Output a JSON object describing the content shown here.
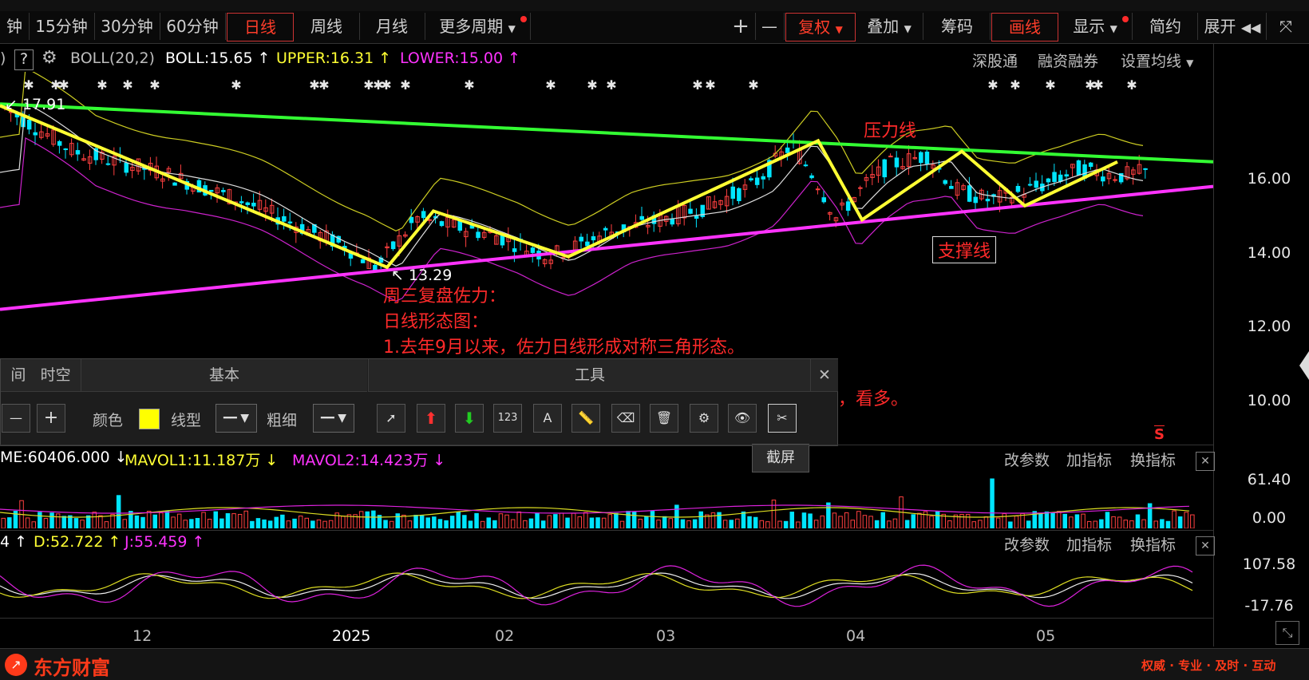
{
  "toolbar": {
    "periods": [
      "钟",
      "15分钟",
      "30分钟",
      "60分钟",
      "日线",
      "周线",
      "月线",
      "更多周期"
    ],
    "active_period": "日线",
    "right": [
      "复权",
      "叠加",
      "筹码",
      "画线",
      "显示",
      "简约",
      "展开"
    ],
    "plus": "+",
    "minus": "—"
  },
  "boll": {
    "qmark": "?",
    "name": "BOLL(20,2)",
    "boll": "BOLL:15.65",
    "upper": "UPPER:16.31",
    "lower": "LOWER:15.00",
    "links": [
      "深股通",
      "融资融券",
      "设置均线"
    ]
  },
  "price": {
    "high_label": "17.91",
    "low_label": "13.29",
    "axis": [
      "16.00",
      "14.00",
      "12.00",
      "10.00"
    ]
  },
  "annotations": {
    "pressure": "压力线",
    "support": "支撑线",
    "line1": "周三复盘佐力：",
    "line2": "日线形态图：",
    "line3": "1.去年9月以来，佐力日线形成对称三角形态。",
    "line4": "，看多。",
    "s_mark": "S"
  },
  "drawpanel": {
    "tabs": [
      "间",
      "时空",
      "基本",
      "工具"
    ],
    "color_label": "颜色",
    "linetype_label": "线型",
    "width_label": "粗细",
    "tooltip": "截屏",
    "close": "✕"
  },
  "volume": {
    "vol": "ME:60406.000",
    "mavol1": "MAVOL1:11.187万",
    "mavol2": "MAVOL2:14.423万",
    "axis": [
      "61.40",
      "0.00"
    ],
    "buttons": [
      "改参数",
      "加指标",
      "换指标"
    ]
  },
  "kdj": {
    "k": "4",
    "d": "D:52.722",
    "j": "J:55.459",
    "axis": [
      "107.58",
      "-17.76"
    ],
    "buttons": [
      "改参数",
      "加指标",
      "换指标"
    ]
  },
  "xaxis": [
    "12",
    "2025",
    "02",
    "03",
    "04",
    "05"
  ],
  "footer": {
    "brand": "东方财富",
    "slogan": "权威 · 专业 · 及时 · 互动"
  },
  "colors": {
    "up": "#ff4040",
    "down": "#00e5ff",
    "pressure_line": "#33ff33",
    "support_line": "#ff33ff",
    "zigzag": "#ffff33",
    "annotation": "#ff2a2a"
  }
}
